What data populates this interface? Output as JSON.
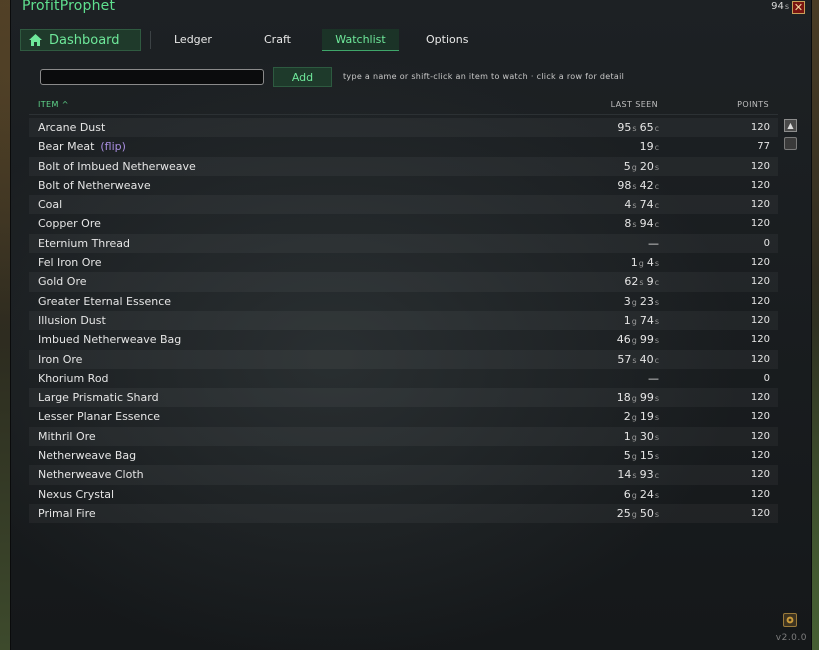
{
  "app": {
    "title": "ProfitProphet"
  },
  "header": {
    "money_value": "94",
    "money_unit": "s",
    "close_glyph": "✕"
  },
  "nav": {
    "dashboard": "Dashboard",
    "tabs": [
      "Ledger",
      "Craft",
      "Watchlist",
      "Options"
    ],
    "active_tab": "Watchlist"
  },
  "search": {
    "value": "",
    "placeholder": "",
    "add_label": "Add",
    "hint": "type a name or shift-click an item to watch  ·  click a row for detail"
  },
  "columns": {
    "item": "ITEM ^",
    "last_seen": "LAST SEEN",
    "points": "POINTS"
  },
  "rows": [
    {
      "name": "Arcane Dust",
      "tag": "",
      "price": [
        [
          "95",
          "s"
        ],
        [
          "65",
          "c"
        ]
      ],
      "points": "120"
    },
    {
      "name": "Bear Meat",
      "tag": "(flip)",
      "price": [
        [
          "19",
          "c"
        ]
      ],
      "points": "77"
    },
    {
      "name": "Bolt of Imbued Netherweave",
      "tag": "",
      "price": [
        [
          "5",
          "g"
        ],
        [
          "20",
          "s"
        ]
      ],
      "points": "120"
    },
    {
      "name": "Bolt of Netherweave",
      "tag": "",
      "price": [
        [
          "98",
          "s"
        ],
        [
          "42",
          "c"
        ]
      ],
      "points": "120"
    },
    {
      "name": "Coal",
      "tag": "",
      "price": [
        [
          "4",
          "s"
        ],
        [
          "74",
          "c"
        ]
      ],
      "points": "120"
    },
    {
      "name": "Copper Ore",
      "tag": "",
      "price": [
        [
          "8",
          "s"
        ],
        [
          "94",
          "c"
        ]
      ],
      "points": "120"
    },
    {
      "name": "Eternium Thread",
      "tag": "",
      "price": [
        [
          "—",
          ""
        ]
      ],
      "points": "0"
    },
    {
      "name": "Fel Iron Ore",
      "tag": "",
      "price": [
        [
          "1",
          "g"
        ],
        [
          "4",
          "s"
        ]
      ],
      "points": "120"
    },
    {
      "name": "Gold Ore",
      "tag": "",
      "price": [
        [
          "62",
          "s"
        ],
        [
          "9",
          "c"
        ]
      ],
      "points": "120"
    },
    {
      "name": "Greater Eternal Essence",
      "tag": "",
      "price": [
        [
          "3",
          "g"
        ],
        [
          "23",
          "s"
        ]
      ],
      "points": "120"
    },
    {
      "name": "Illusion Dust",
      "tag": "",
      "price": [
        [
          "1",
          "g"
        ],
        [
          "74",
          "s"
        ]
      ],
      "points": "120"
    },
    {
      "name": "Imbued Netherweave Bag",
      "tag": "",
      "price": [
        [
          "46",
          "g"
        ],
        [
          "99",
          "s"
        ]
      ],
      "points": "120"
    },
    {
      "name": "Iron Ore",
      "tag": "",
      "price": [
        [
          "57",
          "s"
        ],
        [
          "40",
          "c"
        ]
      ],
      "points": "120"
    },
    {
      "name": "Khorium Rod",
      "tag": "",
      "price": [
        [
          "—",
          ""
        ]
      ],
      "points": "0"
    },
    {
      "name": "Large Prismatic Shard",
      "tag": "",
      "price": [
        [
          "18",
          "g"
        ],
        [
          "99",
          "s"
        ]
      ],
      "points": "120"
    },
    {
      "name": "Lesser Planar Essence",
      "tag": "",
      "price": [
        [
          "2",
          "g"
        ],
        [
          "19",
          "s"
        ]
      ],
      "points": "120"
    },
    {
      "name": "Mithril Ore",
      "tag": "",
      "price": [
        [
          "1",
          "g"
        ],
        [
          "30",
          "s"
        ]
      ],
      "points": "120"
    },
    {
      "name": "Netherweave Bag",
      "tag": "",
      "price": [
        [
          "5",
          "g"
        ],
        [
          "15",
          "s"
        ]
      ],
      "points": "120"
    },
    {
      "name": "Netherweave Cloth",
      "tag": "",
      "price": [
        [
          "14",
          "s"
        ],
        [
          "93",
          "c"
        ]
      ],
      "points": "120"
    },
    {
      "name": "Nexus Crystal",
      "tag": "",
      "price": [
        [
          "6",
          "g"
        ],
        [
          "24",
          "s"
        ]
      ],
      "points": "120"
    },
    {
      "name": "Primal Fire",
      "tag": "",
      "price": [
        [
          "25",
          "g"
        ],
        [
          "50",
          "s"
        ]
      ],
      "points": "120"
    }
  ],
  "footer": {
    "version": "v2.0.0"
  },
  "colors": {
    "accent": "#5fe08f",
    "flip": "#a98ee0",
    "close": "#7a1410"
  }
}
